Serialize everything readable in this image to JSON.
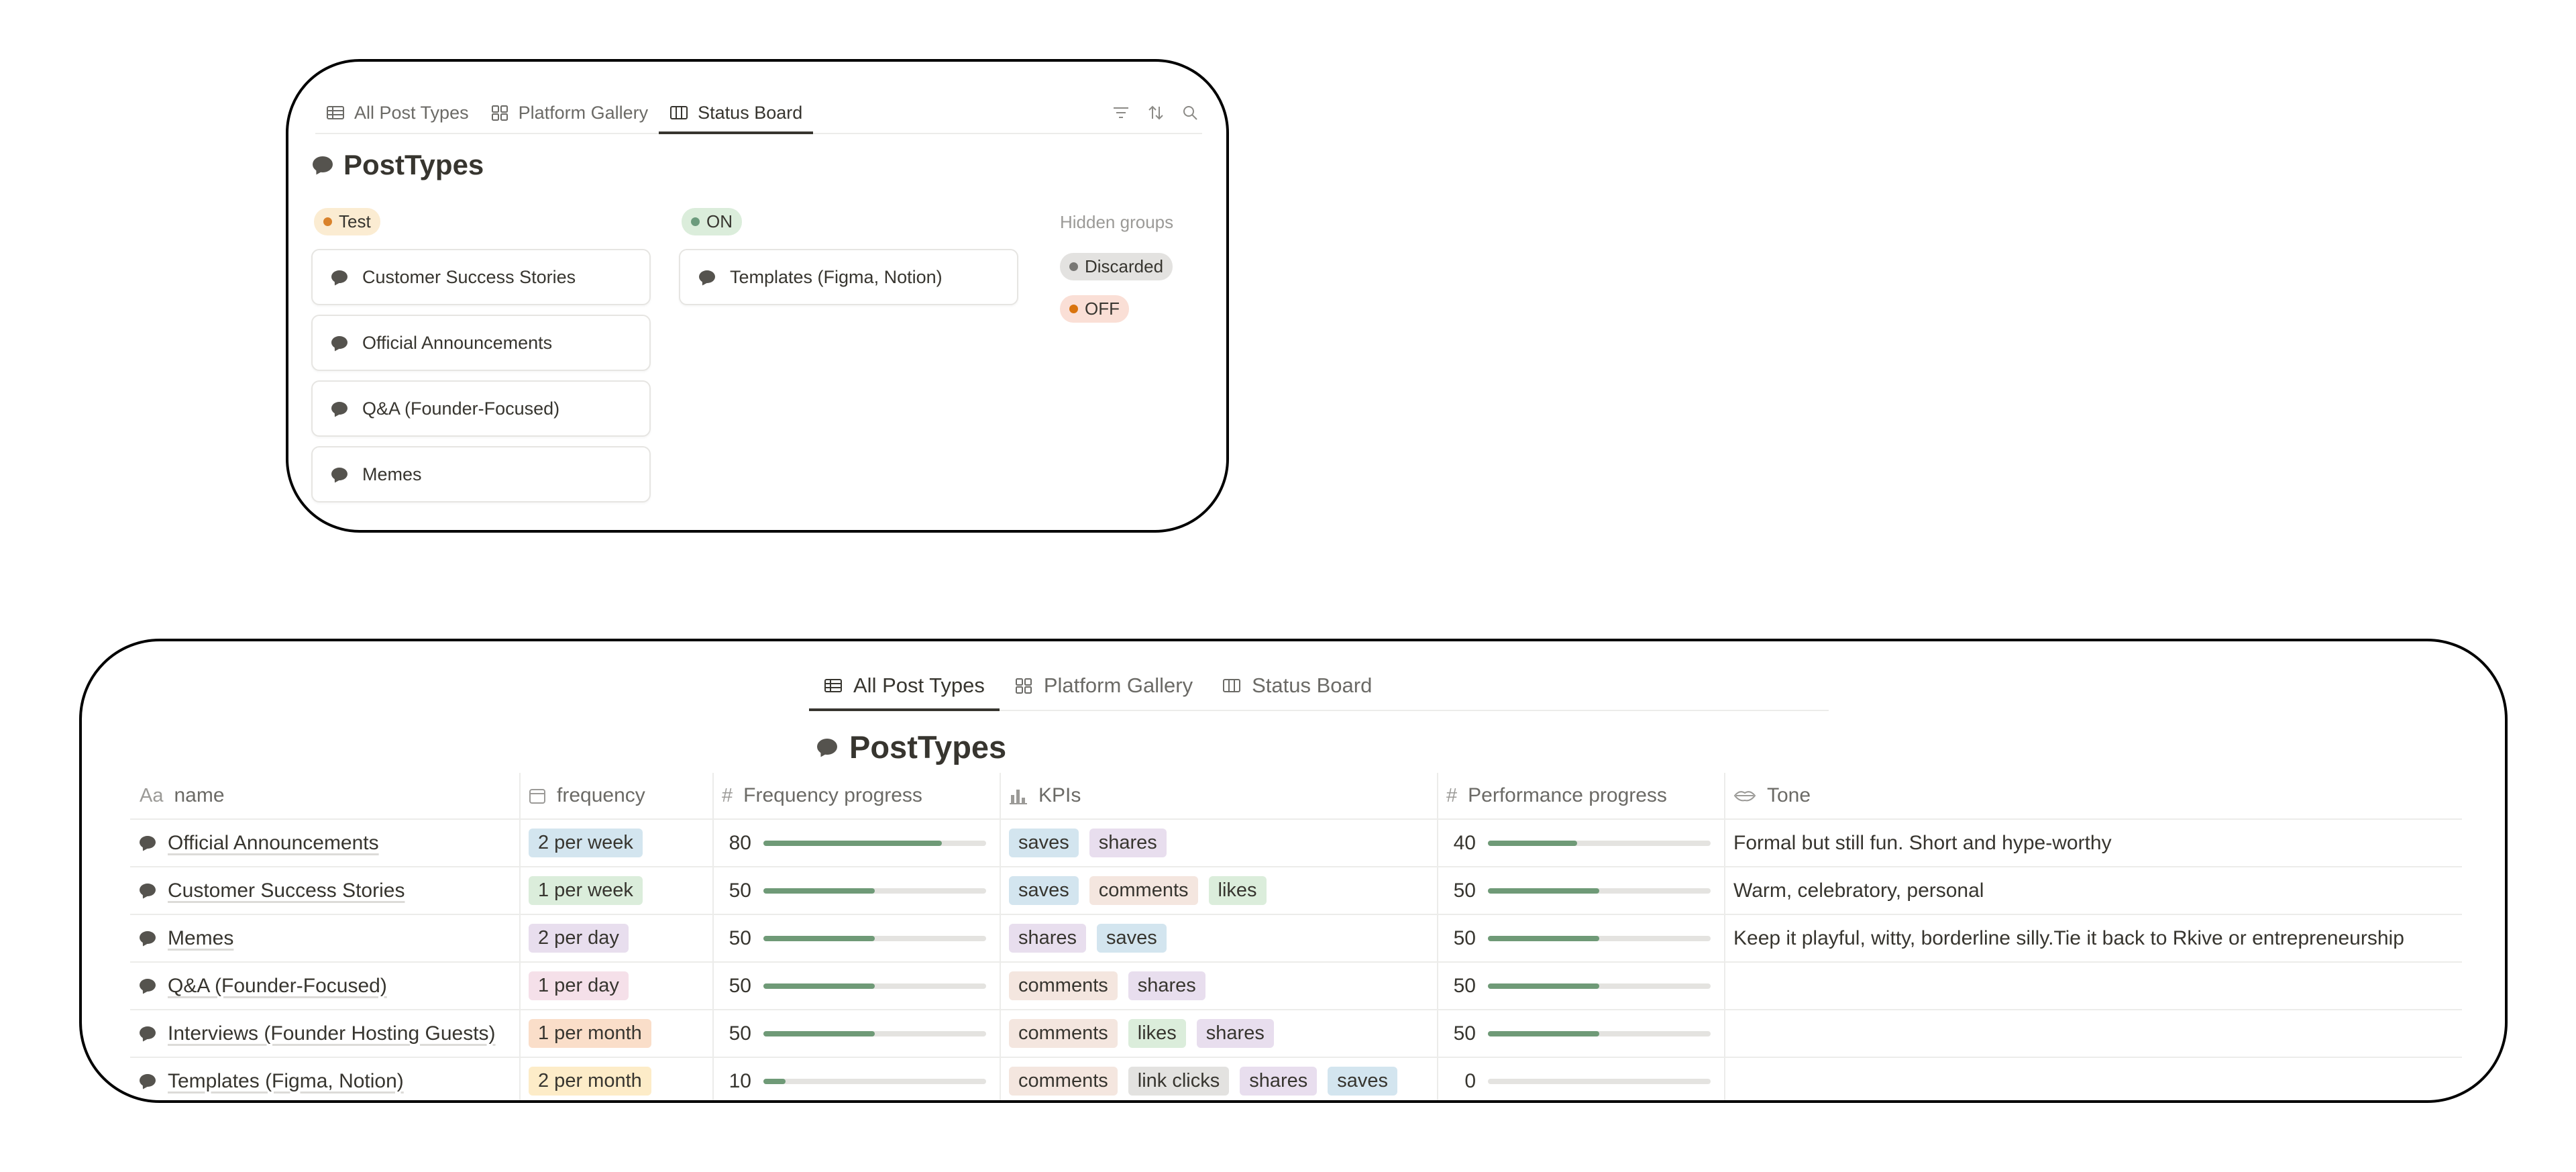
{
  "status_board": {
    "tabs": [
      {
        "label": "All Post Types",
        "icon": "table-icon"
      },
      {
        "label": "Platform Gallery",
        "icon": "gallery-icon"
      },
      {
        "label": "Status Board",
        "icon": "board-icon",
        "active": true
      }
    ],
    "title": "PostTypes",
    "groups": [
      {
        "label": "Test",
        "bg": "#fbecd2",
        "dot": "#d9822b",
        "cards": [
          "Customer Success Stories",
          "Official Announcements",
          "Q&A (Founder-Focused)",
          "Memes"
        ]
      },
      {
        "label": "ON",
        "bg": "#dbeddb",
        "dot": "#6c9b7d",
        "cards": [
          "Templates (Figma, Notion)"
        ]
      }
    ],
    "hidden_groups_label": "Hidden groups",
    "hidden_groups": [
      {
        "label": "Discarded",
        "bg": "#e3e2e0",
        "dot": "#787774"
      },
      {
        "label": "OFF",
        "bg": "#fadfd6",
        "dot": "#d9730d"
      }
    ]
  },
  "all_post_types": {
    "tabs": [
      {
        "label": "All Post Types",
        "icon": "table-icon",
        "active": true
      },
      {
        "label": "Platform Gallery",
        "icon": "gallery-icon"
      },
      {
        "label": "Status Board",
        "icon": "board-icon"
      }
    ],
    "title": "PostTypes",
    "columns": {
      "name": "name",
      "frequency": "frequency",
      "frequency_progress": "Frequency progress",
      "kpis": "KPIs",
      "performance_progress": "Performance progress",
      "tone": "Tone"
    },
    "rows": [
      {
        "name": "Official Announcements",
        "frequency": "2 per week",
        "freq_color": "#d3e5ef",
        "freq_progress": 80,
        "kpis": [
          "saves",
          "shares"
        ],
        "perf_progress": 40,
        "tone": "Formal but still fun. Short and hype-worthy"
      },
      {
        "name": "Customer Success Stories",
        "frequency": "1 per week",
        "freq_color": "#dbeddb",
        "freq_progress": 50,
        "kpis": [
          "saves",
          "comments",
          "likes"
        ],
        "perf_progress": 50,
        "tone": "Warm, celebratory, personal"
      },
      {
        "name": "Memes",
        "frequency": "2 per day",
        "freq_color": "#e8deee",
        "freq_progress": 50,
        "kpis": [
          "shares",
          "saves"
        ],
        "perf_progress": 50,
        "tone": "Keep it playful, witty, borderline silly.Tie it back to Rkive or entrepreneurship"
      },
      {
        "name": "Q&A (Founder-Focused)",
        "frequency": "1 per day",
        "freq_color": "#f5e0e9",
        "freq_progress": 50,
        "kpis": [
          "comments",
          "shares"
        ],
        "perf_progress": 50,
        "tone": ""
      },
      {
        "name": "Interviews (Founder Hosting Guests)",
        "frequency": "1 per month",
        "freq_color": "#fadec9",
        "freq_progress": 50,
        "kpis": [
          "comments",
          "likes",
          "shares"
        ],
        "perf_progress": 50,
        "tone": ""
      },
      {
        "name": "Templates (Figma, Notion)",
        "frequency": "2 per month",
        "freq_color": "#fdecc8",
        "freq_progress": 10,
        "kpis": [
          "comments",
          "link clicks",
          "shares",
          "saves"
        ],
        "perf_progress": 0,
        "tone": ""
      }
    ],
    "kpi_colors": {
      "saves": "#d3e5ef",
      "shares": "#e8deee",
      "comments": "#f4e6df",
      "likes": "#dbeddb",
      "link clicks": "#e3e2e0"
    }
  }
}
